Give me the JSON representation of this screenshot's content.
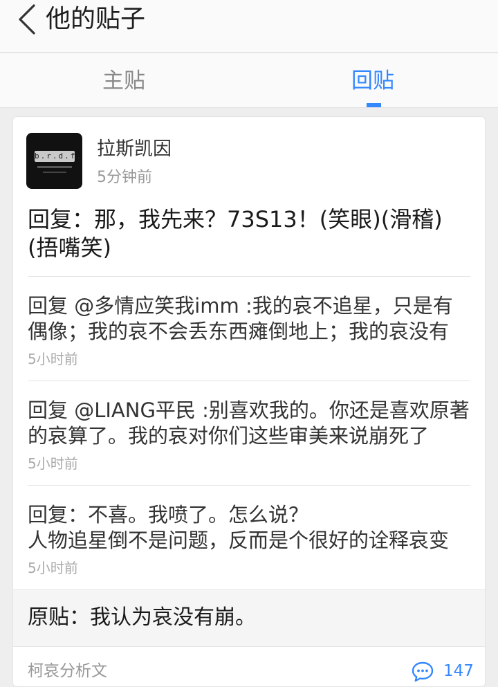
{
  "header": {
    "title": "他的贴子"
  },
  "tabs": [
    {
      "label": "主贴"
    },
    {
      "label": "回贴"
    }
  ],
  "post": {
    "username": "拉斯凯因",
    "avatar_text": "b.r.d.f.",
    "time": "5分钟前",
    "content": "回复：那，我先来？73S13！(笑眼)(滑稽)(捂嘴笑)",
    "sub_replies": [
      {
        "text": "回复 @多情应笑我imm :我的哀不追星，只是有偶像；我的哀不会丢东西瘫倒地上；我的哀没有",
        "time": "5小时前"
      },
      {
        "text": "回复 @LIANG平民 :别喜欢我的。你还是喜欢原著的哀算了。我的哀对你们这些审美来说崩死了",
        "time": "5小时前"
      },
      {
        "text": "回复：不喜。我喷了。怎么说？\n人物追星倒不是问题，反而是个很好的诠释哀变",
        "time": "5小时前"
      }
    ],
    "original": "原贴：我认为哀没有崩。",
    "forum": "柯哀分析文",
    "comment_count": "147"
  },
  "colors": {
    "accent": "#3388ff",
    "muted": "#999999"
  }
}
